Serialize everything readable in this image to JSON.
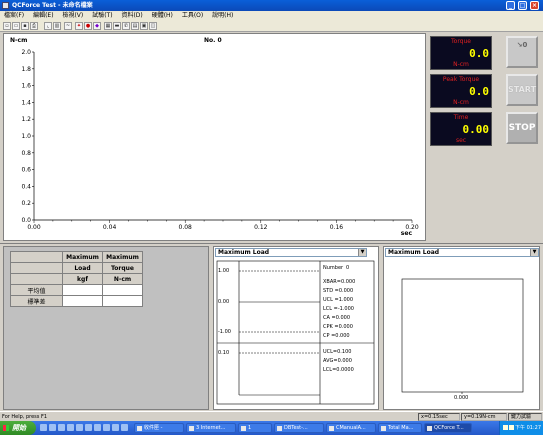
{
  "window": {
    "title": "QCForce Test - 未命名檔案"
  },
  "menu": [
    "檔案(F)",
    "編輯(E)",
    "檢視(V)",
    "試驗(T)",
    "資料(D)",
    "硬體(H)",
    "工具(O)",
    "說明(H)"
  ],
  "toolbar": [
    "new-icon",
    "open-icon",
    "save-icon",
    "print-icon",
    "chart-icon",
    "hist-icon",
    "tool-icon",
    "pin-icon",
    "stop-icon",
    "color-icon",
    "device-icon",
    "meter-icon",
    "phone-icon",
    "grid-icon",
    "export-icon",
    "window-icon"
  ],
  "main_chart": {
    "y_unit": "N-cm",
    "title": "No. 0",
    "x_unit": "sec",
    "y_ticks": [
      "2.0",
      "1.8",
      "1.6",
      "1.4",
      "1.2",
      "1.0",
      "0.8",
      "0.6",
      "0.4",
      "0.2",
      "0.0"
    ],
    "x_ticks": [
      "0.00",
      "0.04",
      "0.08",
      "0.12",
      "0.16",
      "0.20"
    ]
  },
  "chart_data": {
    "type": "line",
    "title": "No. 0",
    "xlabel": "sec",
    "ylabel": "N-cm",
    "xlim": [
      0,
      0.2
    ],
    "ylim": [
      0,
      2.0
    ],
    "series": []
  },
  "displays": [
    {
      "label": "Torque",
      "value": "0.0",
      "unit": "N-cm"
    },
    {
      "label": "Peak Torque",
      "value": "0.0",
      "unit": "N-cm"
    },
    {
      "label": "Time",
      "value": "0.00",
      "unit": "sec"
    }
  ],
  "buttons": {
    "reset": "↘0",
    "start": "START",
    "stop": "STOP"
  },
  "stats_table": {
    "headers": [
      [
        "Maximum",
        "Maximum"
      ],
      [
        "Load",
        "Torque"
      ],
      [
        "kgf",
        "N-cm"
      ]
    ],
    "rows": [
      "平均值",
      "標準差"
    ]
  },
  "spc_panel": {
    "select": "Maximum Load",
    "xbar_ticks": [
      "1.00",
      "0.00",
      "-1.00"
    ],
    "r_tick": "0.10",
    "number_label": "Number",
    "number_value": "0",
    "stats": [
      "XBAR=0.000",
      "STD  =0.000",
      "UCL  =1.000",
      "LCL  =-1.000",
      "CA   =0.000",
      "CPK  =0.000",
      "CP   =0.000"
    ],
    "r_stats": [
      "UCL=0.100",
      "AVG=0.000",
      "LCL=0.0000"
    ]
  },
  "hist_panel": {
    "select": "Maximum Load",
    "x_tick": "0.000"
  },
  "status": {
    "help": "For Help, press F1",
    "x": "x=0.15sec",
    "y": "y=0.19N-cm",
    "mode": "鍵力試驗"
  },
  "taskbar": {
    "start": "開始",
    "items": [
      "收件匣 -",
      "3 Internet...",
      "1",
      "DBTest-...",
      "CManualA...",
      "Total Ma...",
      "QCForce T..."
    ],
    "time": "下午 01:27"
  }
}
